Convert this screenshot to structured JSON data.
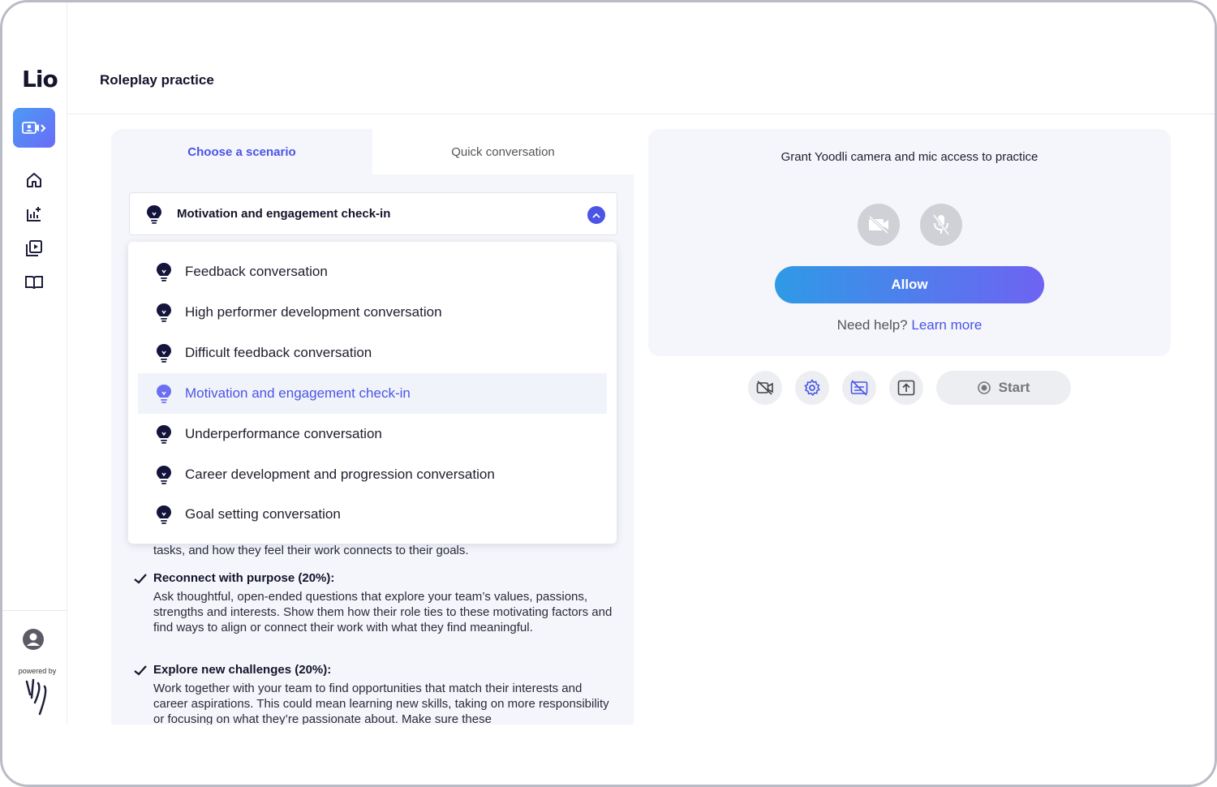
{
  "app": {
    "logo_text": "Lio",
    "powered_by": "powered by"
  },
  "header": {
    "title": "Roleplay practice"
  },
  "sidebar": {
    "items": [
      {
        "name": "roleplay",
        "icon": "video-person-icon",
        "active": true
      },
      {
        "name": "home",
        "icon": "home-icon"
      },
      {
        "name": "analytics",
        "icon": "chart-add-icon"
      },
      {
        "name": "videos",
        "icon": "video-library-icon"
      },
      {
        "name": "library",
        "icon": "book-icon"
      }
    ]
  },
  "tabs": [
    {
      "label": "Choose a scenario",
      "active": true
    },
    {
      "label": "Quick conversation",
      "active": false
    }
  ],
  "scenario_select": {
    "value": "Motivation and engagement check-in",
    "options": [
      {
        "label": "Feedback conversation"
      },
      {
        "label": "High performer development conversation"
      },
      {
        "label": "Difficult feedback conversation"
      },
      {
        "label": "Motivation and engagement check-in",
        "selected": true
      },
      {
        "label": "Underperformance conversation"
      },
      {
        "label": "Career development and progression conversation"
      },
      {
        "label": "Goal setting conversation"
      }
    ]
  },
  "criteria": {
    "partial_text": "tasks, and how they feel their work connects to their goals.",
    "items": [
      {
        "title": "Reconnect with purpose (20%):",
        "text": "Ask thoughtful, open-ended questions that explore your team’s values, passions, strengths and interests. Show them how their role ties to these motivating factors and find ways to align or connect their work with what they find meaningful."
      },
      {
        "title": "Explore new challenges (20%):",
        "text": "Work together with your team to find opportunities that match their interests and career aspirations. This could mean learning new skills, taking on more responsibility or focusing on what they’re passionate about. Make sure these"
      }
    ]
  },
  "permissions": {
    "message": "Grant Yoodli camera and mic access to practice",
    "allow_label": "Allow",
    "help_text": "Need help?",
    "help_link": "Learn more"
  },
  "controls": {
    "start_label": "Start"
  },
  "colors": {
    "accent": "#4a55e6",
    "panel_bg": "#f4f6fb"
  }
}
